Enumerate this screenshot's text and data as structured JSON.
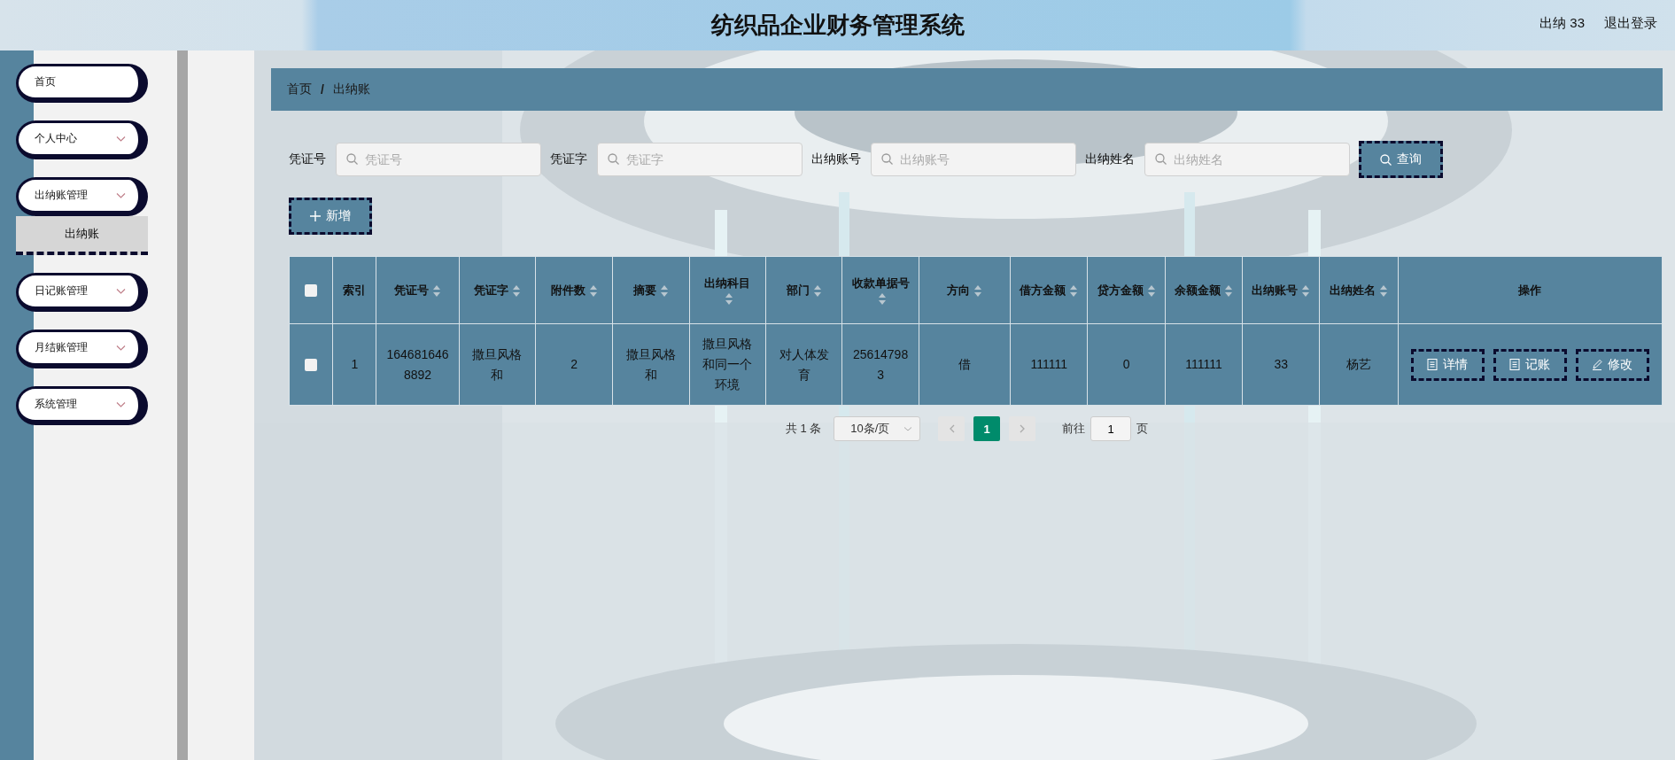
{
  "header": {
    "title": "纺织品企业财务管理系统",
    "user": "出纳 33",
    "logout": "退出登录"
  },
  "sidebar": {
    "items": [
      {
        "label": "首页",
        "kind": "link"
      },
      {
        "label": "个人中心",
        "kind": "submenu"
      },
      {
        "label": "出纳账管理",
        "kind": "submenu",
        "children": [
          {
            "label": "出纳账",
            "selected": true
          }
        ]
      },
      {
        "label": "日记账管理",
        "kind": "submenu"
      },
      {
        "label": "月结账管理",
        "kind": "submenu"
      },
      {
        "label": "系统管理",
        "kind": "submenu"
      }
    ]
  },
  "breadcrumb": {
    "items": [
      "首页",
      "出纳账"
    ],
    "separator": "/"
  },
  "search": {
    "fields": [
      {
        "label": "凭证号",
        "placeholder": "凭证号"
      },
      {
        "label": "凭证字",
        "placeholder": "凭证字"
      },
      {
        "label": "出纳账号",
        "placeholder": "出纳账号"
      },
      {
        "label": "出纳姓名",
        "placeholder": "出纳姓名"
      }
    ],
    "button": "查询"
  },
  "add_button": "新增",
  "table": {
    "header_checked": false,
    "columns": [
      {
        "label": "索引",
        "sortable": false
      },
      {
        "label": "凭证号",
        "sortable": true
      },
      {
        "label": "凭证字",
        "sortable": true
      },
      {
        "label": "附件数",
        "sortable": true
      },
      {
        "label": "摘要",
        "sortable": true
      },
      {
        "label": "出纳科目",
        "sortable": true
      },
      {
        "label": "部门",
        "sortable": true
      },
      {
        "label": "收款单据号",
        "sortable": true
      },
      {
        "label": "方向",
        "sortable": true
      },
      {
        "label": "借方金额",
        "sortable": true
      },
      {
        "label": "贷方金额",
        "sortable": true
      },
      {
        "label": "余额金额",
        "sortable": true
      },
      {
        "label": "出纳账号",
        "sortable": true
      },
      {
        "label": "出纳姓名",
        "sortable": true
      },
      {
        "label": "操作",
        "sortable": false
      }
    ],
    "rows": [
      {
        "selected": false,
        "cells": [
          "1",
          "1646816468892",
          "撒旦风格和",
          "2",
          "撒旦风格和",
          "撒旦风格和同一个环境",
          "对人体发育",
          "256147983",
          "借",
          "111111",
          "0",
          "111111",
          "33",
          "杨艺"
        ],
        "actions": [
          {
            "label": "详情",
            "kind": "detail"
          },
          {
            "label": "记账",
            "kind": "record"
          },
          {
            "label": "修改",
            "kind": "edit"
          }
        ]
      }
    ]
  },
  "pagination": {
    "total": "共 1 条",
    "page_size": "10条/页",
    "pages": [
      {
        "label": "1",
        "selected": true
      }
    ],
    "goto_label": "前往",
    "goto_value": "1",
    "page_suffix": "页"
  }
}
